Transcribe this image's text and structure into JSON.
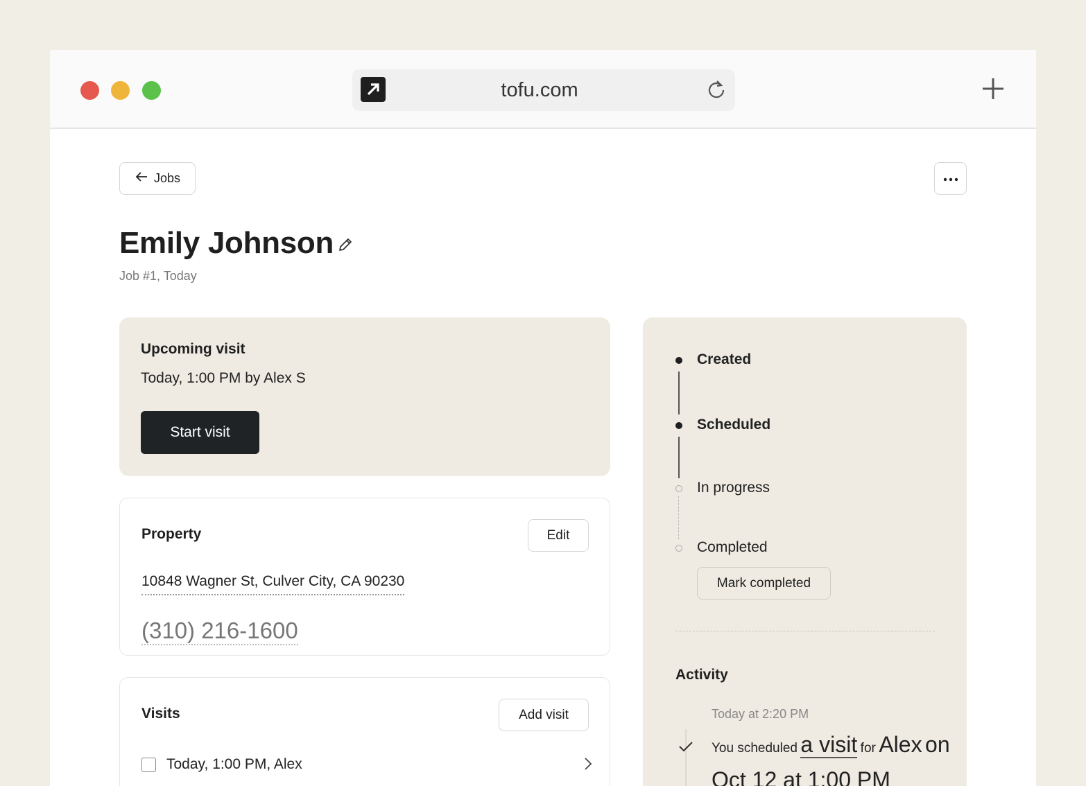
{
  "browser": {
    "url": "tofu.com",
    "controls": [
      "close",
      "minimize",
      "maximize"
    ]
  },
  "nav": {
    "back_label": "Jobs"
  },
  "job": {
    "customer_name": "Emily Johnson",
    "subtitle": "Job #1, Today"
  },
  "upcoming_visit": {
    "title": "Upcoming visit",
    "detail": "Today, 1:00 PM by Alex S",
    "start_label": "Start visit"
  },
  "property": {
    "title": "Property",
    "edit_label": "Edit",
    "address": "10848 Wagner St, Culver City, CA 90230",
    "phone": "(310) 216-1600"
  },
  "visits": {
    "title": "Visits",
    "add_label": "Add visit",
    "items": [
      {
        "label": "Today, 1:00 PM, Alex"
      }
    ]
  },
  "status": {
    "steps": [
      {
        "label": "Created",
        "state": "done"
      },
      {
        "label": "Scheduled",
        "state": "done"
      },
      {
        "label": "In progress",
        "state": "pending"
      },
      {
        "label": "Completed",
        "state": "pending"
      }
    ],
    "mark_completed_label": "Mark completed"
  },
  "activity": {
    "title": "Activity",
    "entries": [
      {
        "time": "Today at 2:20 PM",
        "prefix": "You scheduled",
        "link": "a visit",
        "mid": "for",
        "name": "Alex",
        "when": "on Oct 12 at 1:00 PM"
      }
    ]
  },
  "colors": {
    "background": "#f1eee6",
    "card_beige": "#efebe2",
    "primary_button": "#1f2326",
    "close": "#e5594f",
    "minimize": "#efb53a",
    "maximize": "#5bc14a"
  }
}
